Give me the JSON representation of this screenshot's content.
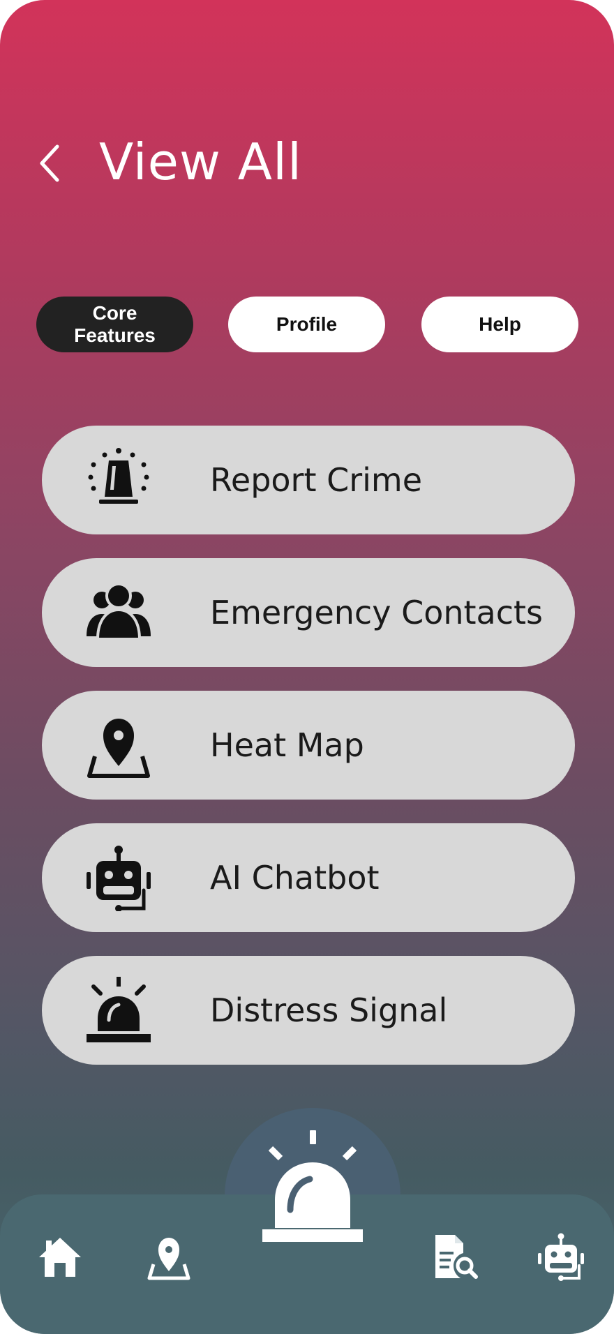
{
  "header": {
    "back_icon": "chevron-left-icon",
    "title": "View All"
  },
  "tabs": [
    {
      "label": "Core\nFeatures",
      "active": true
    },
    {
      "label": "Profile",
      "active": false
    },
    {
      "label": "Help",
      "active": false
    }
  ],
  "features": [
    {
      "label": "Report Crime",
      "icon": "siren-light-icon"
    },
    {
      "label": "Emergency Contacts",
      "icon": "contacts-group-icon"
    },
    {
      "label": "Heat Map",
      "icon": "map-pin-icon"
    },
    {
      "label": "AI Chatbot",
      "icon": "robot-icon"
    },
    {
      "label": "Distress Signal",
      "icon": "alarm-icon"
    }
  ],
  "bottom_nav": {
    "items": [
      {
        "icon": "home-icon"
      },
      {
        "icon": "map-pin-icon"
      },
      {
        "icon": "alarm-icon",
        "primary": true
      },
      {
        "icon": "report-search-icon"
      },
      {
        "icon": "robot-icon"
      }
    ]
  },
  "colors": {
    "gradient_top": "#d2335a",
    "gradient_bottom": "#4a6870",
    "card_bg": "#d8d8d8",
    "active_tab": "#222222",
    "fab_bump": "#4a6072"
  }
}
